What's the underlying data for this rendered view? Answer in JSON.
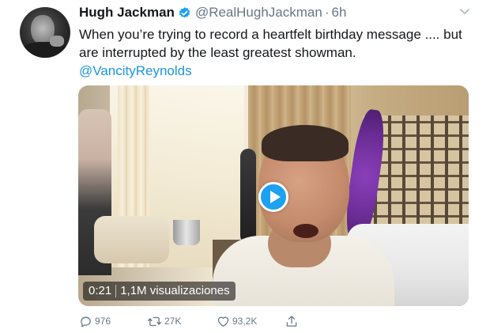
{
  "tweet": {
    "author_name": "Hugh Jackman",
    "handle": "@RealHughJackman",
    "separator": "·",
    "time": "6h",
    "text_line1": "When you’re trying to record a heartfelt birthday message .... but",
    "text_line2": "are interrupted by the least greatest showman.",
    "mention": "@VancityReynolds"
  },
  "video": {
    "duration": "0:21",
    "views": "1,1M visualizaciones"
  },
  "actions": {
    "replies": "976",
    "retweets": "27K",
    "likes": "93,2K"
  },
  "colors": {
    "link": "#1b95e0",
    "secondary_text": "#657786",
    "verified": "#1da1f2",
    "play_button": "#1da1f2"
  },
  "icons": [
    "verified-badge-icon",
    "chevron-down-icon",
    "play-icon",
    "reply-icon",
    "retweet-icon",
    "like-icon",
    "share-icon"
  ]
}
